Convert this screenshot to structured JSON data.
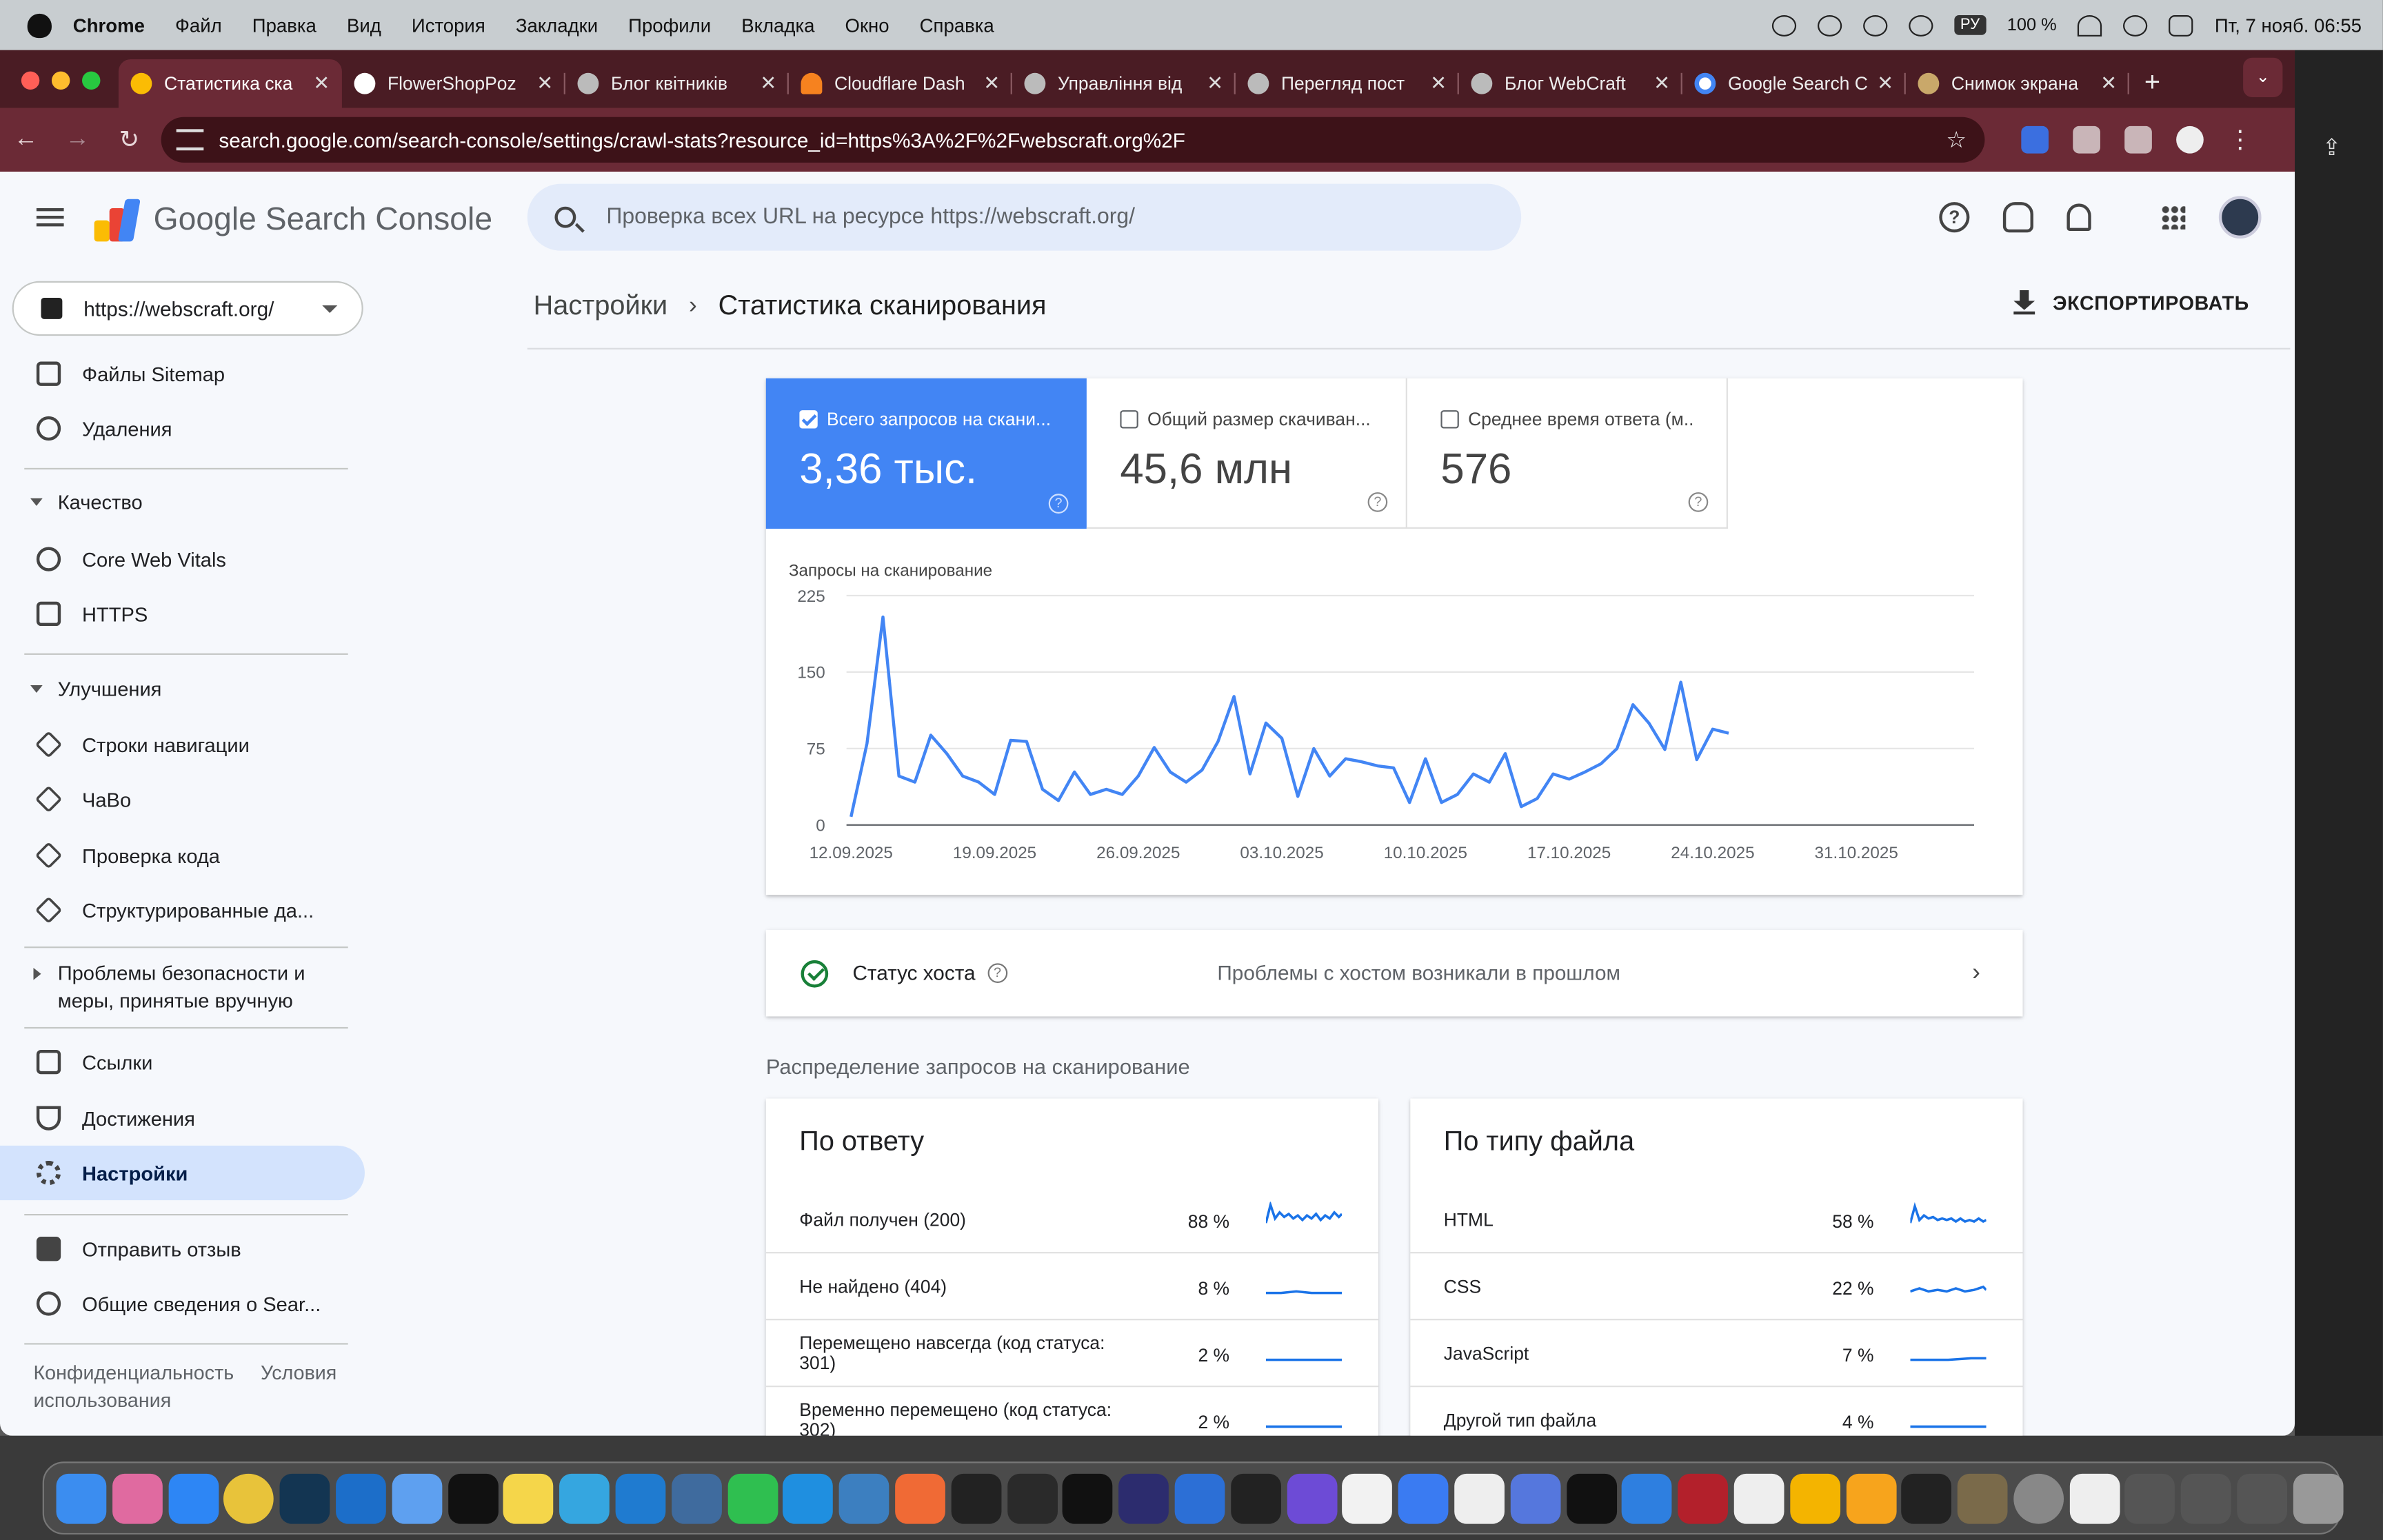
{
  "menubar": {
    "app": "Chrome",
    "items": [
      "Файл",
      "Правка",
      "Вид",
      "История",
      "Закладки",
      "Профили",
      "Вкладка",
      "Окно",
      "Справка"
    ],
    "lang": "РУ",
    "battery": "100 %",
    "datetime": "Пт, 7 нояб. 06:55"
  },
  "tabs": [
    {
      "label": "Статистика ска",
      "active": true
    },
    {
      "label": "FlowerShopPoz",
      "active": false
    },
    {
      "label": "Блог квітників",
      "active": false
    },
    {
      "label": "Cloudflare Dash",
      "active": false
    },
    {
      "label": "Управління від",
      "active": false
    },
    {
      "label": "Перегляд пост",
      "active": false
    },
    {
      "label": "Блог WebCraft",
      "active": false
    },
    {
      "label": "Google Search C",
      "active": false
    },
    {
      "label": "Снимок экрана",
      "active": false
    }
  ],
  "address": {
    "url": "search.google.com/search-console/settings/crawl-stats?resource_id=https%3A%2F%2Fwebscraft.org%2F"
  },
  "header": {
    "logo_google": "Google",
    "logo_product": "Search Console",
    "search_placeholder": "Проверка всех URL на ресурсе https://webscraft.org/"
  },
  "sidebar": {
    "property": "https://webscraft.org/",
    "items": [
      {
        "id": "sitemaps",
        "label": "Файлы Sitemap",
        "icon": "sitemap-icon"
      },
      {
        "id": "removals",
        "label": "Удаления",
        "icon": "removals-icon"
      }
    ],
    "quality_label": "Качество",
    "quality_items": [
      {
        "id": "cwv",
        "label": "Core Web Vitals",
        "icon": "speed-icon"
      },
      {
        "id": "https",
        "label": "HTTPS",
        "icon": "lock-icon"
      }
    ],
    "enh_label": "Улучшения",
    "enh_items": [
      {
        "id": "breadcrumbs",
        "label": "Строки навигации",
        "icon": "layers-icon"
      },
      {
        "id": "faq",
        "label": "ЧаВо",
        "icon": "layers-icon"
      },
      {
        "id": "snippets",
        "label": "Проверка кода",
        "icon": "layers-icon"
      },
      {
        "id": "structured",
        "label": "Структурированные да...",
        "icon": "layers-icon"
      }
    ],
    "security_label": "Проблемы безопасности и меры, принятые вручную",
    "bottom_items": [
      {
        "id": "links",
        "label": "Ссылки",
        "icon": "links-icon"
      },
      {
        "id": "achievements",
        "label": "Достижения",
        "icon": "trophy-icon"
      },
      {
        "id": "settings",
        "label": "Настройки",
        "icon": "gear-icon"
      }
    ],
    "feedback_label": "Отправить отзыв",
    "about_label": "Общие сведения о Sear...",
    "privacy": "Конфиденциальность",
    "terms": "Условия использования"
  },
  "main": {
    "breadcrumb_parent": "Настройки",
    "breadcrumb_current": "Статистика сканирования",
    "export_label": "ЭКСПОРТИРОВАТЬ",
    "metrics": [
      {
        "label": "Всего запросов на скани...",
        "value": "3,36 тыс.",
        "selected": true
      },
      {
        "label": "Общий размер скачиван...",
        "value": "45,6 млн",
        "selected": false
      },
      {
        "label": "Среднее время ответа (м...",
        "value": "576",
        "selected": false
      }
    ],
    "host_status_label": "Статус хоста",
    "host_status_message": "Проблемы с хостом возникали в прошлом",
    "distribution_label": "Распределение запросов на сканирование",
    "by_response_title": "По ответу",
    "by_response": [
      {
        "label": "Файл получен (200)",
        "percent": "88 %"
      },
      {
        "label": "Не найдено (404)",
        "percent": "8 %"
      },
      {
        "label": "Перемещено навсегда (код статуса: 301)",
        "percent": "2 %"
      },
      {
        "label": "Временно перемещено (код статуса: 302)",
        "percent": "2 %"
      }
    ],
    "by_filetype_title": "По типу файла",
    "by_filetype": [
      {
        "label": "HTML",
        "percent": "58 %"
      },
      {
        "label": "CSS",
        "percent": "22 %"
      },
      {
        "label": "JavaScript",
        "percent": "7 %"
      },
      {
        "label": "Другой тип файла",
        "percent": "4 %"
      }
    ]
  },
  "chart_data": {
    "type": "line",
    "title": "",
    "ylabel": "Запросы на сканирование",
    "xlabel": "",
    "ylim": [
      0,
      225
    ],
    "yticks": [
      0,
      75,
      150,
      225
    ],
    "xticks": [
      "12.09.2025",
      "19.09.2025",
      "26.09.2025",
      "03.10.2025",
      "10.10.2025",
      "17.10.2025",
      "24.10.2025",
      "31.10.2025"
    ],
    "grid": true,
    "color": "#4285f4",
    "series": [
      {
        "values": [
          8,
          80,
          204,
          48,
          42,
          88,
          70,
          48,
          42,
          30,
          83,
          82,
          35,
          24,
          52,
          30,
          35,
          30,
          48,
          76,
          52,
          42,
          54,
          82,
          126,
          50,
          100,
          85,
          28,
          75,
          48,
          65,
          62,
          58,
          56,
          22,
          65,
          22,
          30,
          50,
          42,
          70,
          18,
          26,
          50,
          45,
          52,
          60,
          75,
          118,
          100,
          74,
          140,
          64,
          94,
          90
        ]
      }
    ]
  }
}
